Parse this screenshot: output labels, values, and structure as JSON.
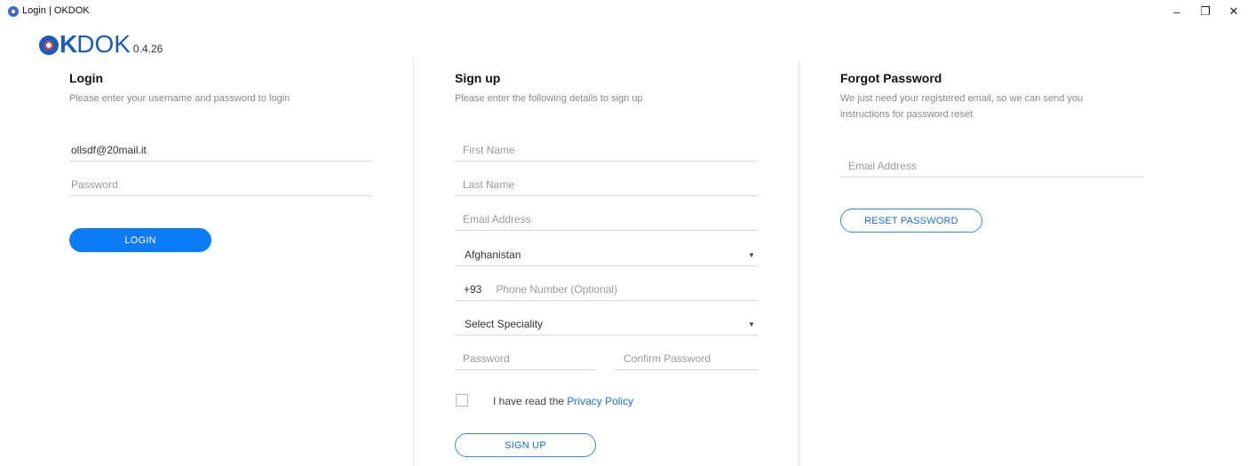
{
  "window": {
    "title": "Login | OKDOK",
    "controls": {
      "minimize": "–",
      "restore": "❐",
      "close": "✕"
    }
  },
  "logo": {
    "ok": "K",
    "dok": "DOK",
    "version": "0.4.26"
  },
  "login": {
    "title": "Login",
    "subtitle": "Please enter your username and password to login",
    "username_value": "ollsdf@20mail.it",
    "password_placeholder": "Password",
    "button_label": "LOGIN"
  },
  "signup": {
    "title": "Sign up",
    "subtitle": "Please enter the following details to sign up",
    "first_name_placeholder": "First Name",
    "last_name_placeholder": "Last Name",
    "email_placeholder": "Email Address",
    "country_value": "Afghanistan",
    "phone_code": "+93",
    "phone_placeholder": "Phone Number (Optional)",
    "speciality_value": "Select Speciality",
    "password_placeholder": "Password",
    "confirm_password_placeholder": "Confirm Password",
    "privacy_prefix": "I have read the",
    "privacy_link": "Privacy Policy",
    "button_label": "SIGN UP"
  },
  "forgot": {
    "title": "Forgot Password",
    "subtitle": "We just need your registered email, so we can send you instructions for password reset",
    "email_placeholder": "Email Address",
    "button_label": "RESET PASSWORD"
  },
  "colors": {
    "primary": "#0b7cf4",
    "brand": "#1e5bb8",
    "link": "#1e6fd8"
  }
}
